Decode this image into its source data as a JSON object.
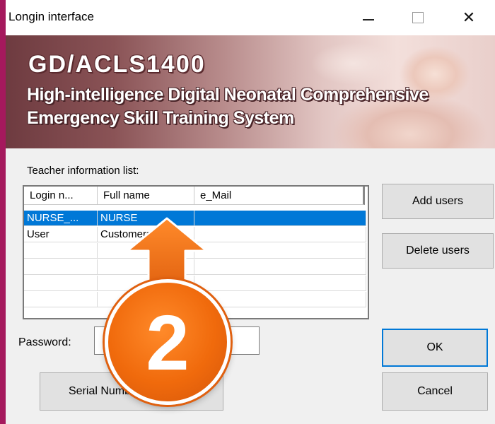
{
  "window": {
    "title": "Longin interface",
    "controls": {
      "minimize": "minimize-icon",
      "maximize": "maximize-icon",
      "close": "close-icon"
    }
  },
  "banner": {
    "code": "GD/ACLS1400",
    "line1": "High-intelligence Digital Neonatal Comprehensive",
    "line2": "Emergency Skill Training System"
  },
  "teacher_list": {
    "label": "Teacher information list:",
    "columns": [
      "Login n...",
      "Full name",
      "e_Mail"
    ],
    "rows": [
      {
        "login": "NURSE_...",
        "full_name": "NURSE",
        "email": "",
        "selected": true
      },
      {
        "login": "User",
        "full_name": "Customers",
        "email": "",
        "selected": false
      }
    ]
  },
  "buttons": {
    "add_users": "Add users",
    "delete_users": "Delete users",
    "ok": "OK",
    "cancel": "Cancel",
    "serial": "Serial Number"
  },
  "password": {
    "label": "Password:",
    "value": ""
  },
  "annotation": {
    "step_number": "2",
    "color": "#f06a0c"
  },
  "colors": {
    "selection": "#0078d7",
    "frame": "#a5195d"
  }
}
